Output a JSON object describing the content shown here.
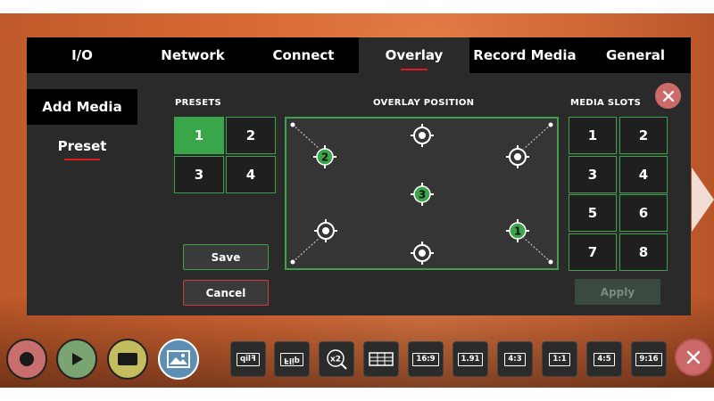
{
  "tabs": [
    {
      "label": "I/O",
      "active": false
    },
    {
      "label": "Network",
      "active": false
    },
    {
      "label": "Connect",
      "active": false
    },
    {
      "label": "Overlay",
      "active": true
    },
    {
      "label": "Record Media",
      "active": false
    },
    {
      "label": "General",
      "active": false
    }
  ],
  "sidebar": {
    "items": [
      {
        "label": "Add Media",
        "active": true
      },
      {
        "label": "Preset",
        "active": false
      }
    ]
  },
  "presets": {
    "label": "PRESETS",
    "buttons": [
      "1",
      "2",
      "3",
      "4"
    ],
    "selected": "1"
  },
  "overlay_position": {
    "label": "OVERLAY POSITION",
    "markers": [
      "2",
      "3",
      "1"
    ]
  },
  "media_slots": {
    "label": "MEDIA SLOTS",
    "buttons": [
      "1",
      "2",
      "3",
      "4",
      "5",
      "6",
      "7",
      "8"
    ]
  },
  "actions": {
    "save_label": "Save",
    "cancel_label": "Cancel",
    "apply_label": "Apply"
  },
  "toolbar": {
    "tools": [
      "Flip",
      "Flip",
      "x2",
      "grid",
      "16:9",
      "1.91",
      "4:3",
      "1:1",
      "4:5",
      "9:16"
    ]
  },
  "colors": {
    "accent_green": "#3aa64a",
    "accent_red": "#d81e1e",
    "close_red": "#cc6a6a",
    "panel_bg": "#2a2a2a",
    "tab_bg": "#000000"
  }
}
